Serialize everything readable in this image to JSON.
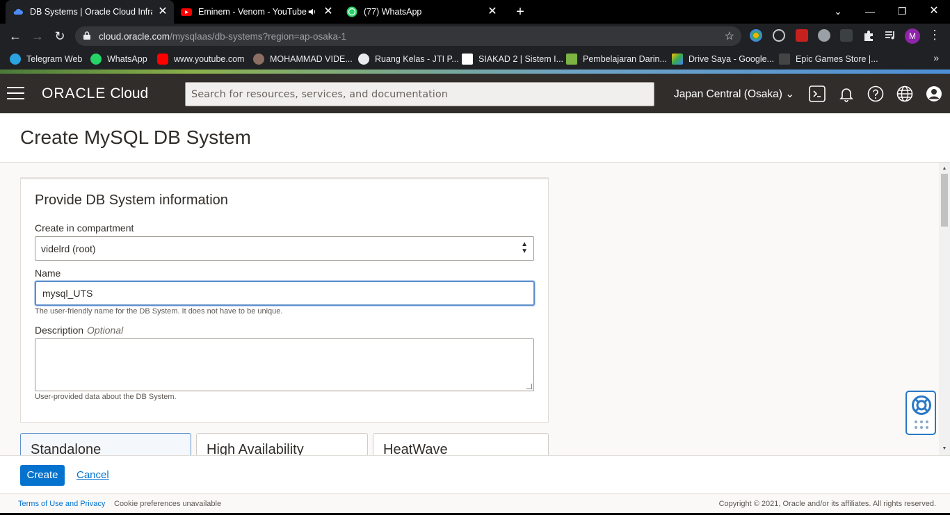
{
  "browser": {
    "tabs": [
      {
        "title": "DB Systems | Oracle Cloud Infrast"
      },
      {
        "title": "Eminem - Venom - YouTube"
      },
      {
        "title": "(77) WhatsApp"
      }
    ],
    "url_host": "cloud.oracle.com",
    "url_path": "/mysqlaas/db-systems?region=ap-osaka-1",
    "profile_initial": "M",
    "bookmarks": [
      {
        "label": "Telegram Web"
      },
      {
        "label": "WhatsApp"
      },
      {
        "label": "www.youtube.com"
      },
      {
        "label": "MOHAMMAD VIDE..."
      },
      {
        "label": "Ruang Kelas - JTI P..."
      },
      {
        "label": "SIAKAD 2 | Sistem I..."
      },
      {
        "label": "Pembelajaran Darin..."
      },
      {
        "label": "Drive Saya - Google..."
      },
      {
        "label": "Epic Games Store |..."
      }
    ]
  },
  "oracle": {
    "logo_brand": "ORACLE",
    "logo_product": "Cloud",
    "search_placeholder": "Search for resources, services, and documentation",
    "region": "Japan Central (Osaka)"
  },
  "page": {
    "title": "Create MySQL DB System",
    "section_title": "Provide DB System information",
    "compartment_label": "Create in compartment",
    "compartment_value": "videlrd (root)",
    "name_label": "Name",
    "name_value": "mysql_UTS",
    "name_help": "The user-friendly name for the DB System. It does not have to be unique.",
    "description_label": "Description",
    "description_optional": "Optional",
    "description_help": "User-provided data about the DB System.",
    "options": [
      {
        "label": "Standalone"
      },
      {
        "label": "High Availability"
      },
      {
        "label": "HeatWave"
      }
    ],
    "create_label": "Create",
    "cancel_label": "Cancel"
  },
  "footer": {
    "terms": "Terms of Use and Privacy",
    "cookies": "Cookie preferences unavailable",
    "copyright": "Copyright © 2021, Oracle and/or its affiliates. All rights reserved."
  },
  "colors": {
    "oracle_header": "#312d2a",
    "primary": "#0572ce",
    "focus": "#5e8fcb"
  }
}
